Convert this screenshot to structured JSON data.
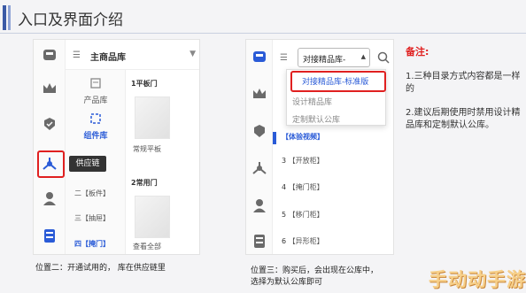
{
  "header": {
    "title": "入口及界面介绍"
  },
  "panel_left": {
    "library_title": "主商品库",
    "categories": [
      {
        "label": "产品库",
        "icon": "product-library-icon"
      },
      {
        "label": "组件库",
        "icon": "component-library-icon"
      }
    ],
    "subcategories": [
      "二【板件】",
      "三【抽屉】",
      "四【掩门】"
    ],
    "tooltip": "供应链",
    "groups": [
      "1平板门",
      "2常用门"
    ],
    "products": [
      "常规平板",
      "查看全部"
    ]
  },
  "panel_middle": {
    "select_value": "对接精品库-",
    "dropdown_options": [
      "对接精品库-标准版",
      "设计精品库",
      "定制默认公库"
    ],
    "items": [
      {
        "num": "",
        "label": "【体验视频】"
      },
      {
        "num": "3",
        "label": "【开放柜】"
      },
      {
        "num": "4",
        "label": "【掩门柜】"
      },
      {
        "num": "5",
        "label": "【移门柜】"
      },
      {
        "num": "6",
        "label": "【异形柜】"
      }
    ]
  },
  "notes": {
    "title": "备注:",
    "lines": [
      "1.三种目录方式内容都是一样的",
      "2.建议后期使用时禁用设计精品库和定制默认公库。"
    ]
  },
  "captions": {
    "left": "位置二：开通试用的， 库在供应链里",
    "middle_line1": "位置三：购买后，会出现在公库中，",
    "middle_line2": "选择为默认公库即可"
  },
  "watermark": "手动动手游",
  "colors": {
    "accent": "#2a5bd7",
    "highlight": "#e02020",
    "header_bar": "#3b5aa6"
  }
}
